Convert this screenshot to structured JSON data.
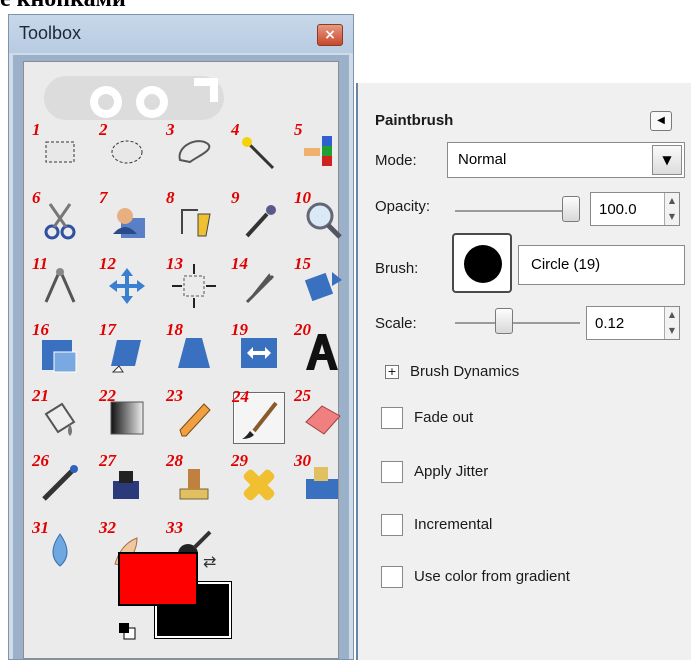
{
  "heading": "е кнопками",
  "toolbox": {
    "title": "Toolbox",
    "close_label": "×",
    "tools": [
      {
        "num": "1",
        "name": "rect-select"
      },
      {
        "num": "2",
        "name": "ellipse-select"
      },
      {
        "num": "3",
        "name": "free-select"
      },
      {
        "num": "4",
        "name": "fuzzy-select"
      },
      {
        "num": "5",
        "name": "select-by-color"
      },
      {
        "num": "6",
        "name": "scissors-select"
      },
      {
        "num": "7",
        "name": "foreground-select"
      },
      {
        "num": "8",
        "name": "paths"
      },
      {
        "num": "9",
        "name": "color-picker"
      },
      {
        "num": "10",
        "name": "zoom"
      },
      {
        "num": "11",
        "name": "measure"
      },
      {
        "num": "12",
        "name": "move"
      },
      {
        "num": "13",
        "name": "alignment"
      },
      {
        "num": "14",
        "name": "crop"
      },
      {
        "num": "15",
        "name": "rotate"
      },
      {
        "num": "16",
        "name": "scale"
      },
      {
        "num": "17",
        "name": "shear"
      },
      {
        "num": "18",
        "name": "perspective"
      },
      {
        "num": "19",
        "name": "flip"
      },
      {
        "num": "20",
        "name": "text"
      },
      {
        "num": "21",
        "name": "bucket-fill"
      },
      {
        "num": "22",
        "name": "blend"
      },
      {
        "num": "23",
        "name": "pencil"
      },
      {
        "num": "24",
        "name": "paintbrush"
      },
      {
        "num": "25",
        "name": "eraser"
      },
      {
        "num": "26",
        "name": "airbrush"
      },
      {
        "num": "27",
        "name": "ink"
      },
      {
        "num": "28",
        "name": "clone"
      },
      {
        "num": "29",
        "name": "heal"
      },
      {
        "num": "30",
        "name": "perspective-clone"
      },
      {
        "num": "31",
        "name": "blur"
      },
      {
        "num": "32",
        "name": "smudge"
      },
      {
        "num": "33",
        "name": "dodge-burn"
      }
    ],
    "active_tool": "paintbrush",
    "foreground_color": "#ff0000",
    "background_color": "#000000"
  },
  "options": {
    "title": "Paintbrush",
    "mode_label": "Mode:",
    "mode_value": "Normal",
    "opacity_label": "Opacity:",
    "opacity_value": "100.0",
    "opacity_fraction": 1.0,
    "brush_label": "Brush:",
    "brush_name": "Circle (19)",
    "scale_label": "Scale:",
    "scale_value": "0.12",
    "expander_symbol": "+",
    "brush_dynamics_label": "Brush Dynamics",
    "checkboxes": [
      "Fade out",
      "Apply Jitter",
      "Incremental",
      "Use color from gradient"
    ]
  }
}
